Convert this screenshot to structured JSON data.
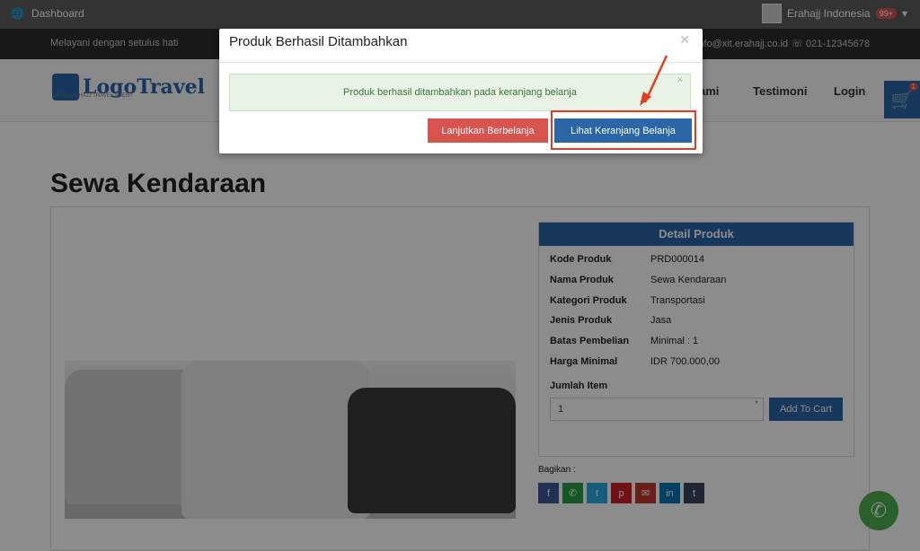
{
  "topbar": {
    "dashboard": "Dashboard",
    "user": "Erahajj Indonesia",
    "badge": "99+"
  },
  "subbar": {
    "slogan": "Melayani dengan setulus hati",
    "contact": "info@xit.erahajj.co.id ☏ 021-12345678"
  },
  "header": {
    "logo": "LogoTravel",
    "logo_sub": "UMRAH & HAJJ TRAVEL AGENT",
    "nav": [
      "ami",
      "Testimoni",
      "Login"
    ],
    "cart_badge": "1"
  },
  "page": {
    "title": "Sewa Kendaraan"
  },
  "detail": {
    "header": "Detail Produk",
    "rows": [
      {
        "k": "Kode Produk",
        "v": "PRD000014"
      },
      {
        "k": "Nama Produk",
        "v": "Sewa Kendaraan"
      },
      {
        "k": "Kategori Produk",
        "v": "Transportasi"
      },
      {
        "k": "Jenis Produk",
        "v": "Jasa"
      },
      {
        "k": "Batas Pembelian",
        "v": "Minimal : 1"
      },
      {
        "k": "Harga Minimal",
        "v": "IDR 700.000,00"
      }
    ],
    "qty_label": "Jumlah Item",
    "qty_value": "1",
    "add_cart": "Add To Cart"
  },
  "share": {
    "label": "Bagikan :",
    "icons": [
      "facebook-icon",
      "whatsapp-icon",
      "twitter-icon",
      "pinterest-icon",
      "email-icon",
      "linkedin-icon",
      "tumblr-icon"
    ],
    "colors": [
      "#3b5998",
      "#25a244",
      "#29a9e1",
      "#cb2027",
      "#c0392b",
      "#0077b5",
      "#35465c"
    ]
  },
  "modal": {
    "title": "Produk Berhasil Ditambahkan",
    "message": "Produk berhasil ditambahkan pada keranjang belanja",
    "continue": "Lanjutkan Berbelanja",
    "view_cart": "Lihat Keranjang Belanja"
  },
  "colors": {
    "brand": "#2a66a8",
    "danger": "#d9534f",
    "highlight": "#e53b1e"
  }
}
